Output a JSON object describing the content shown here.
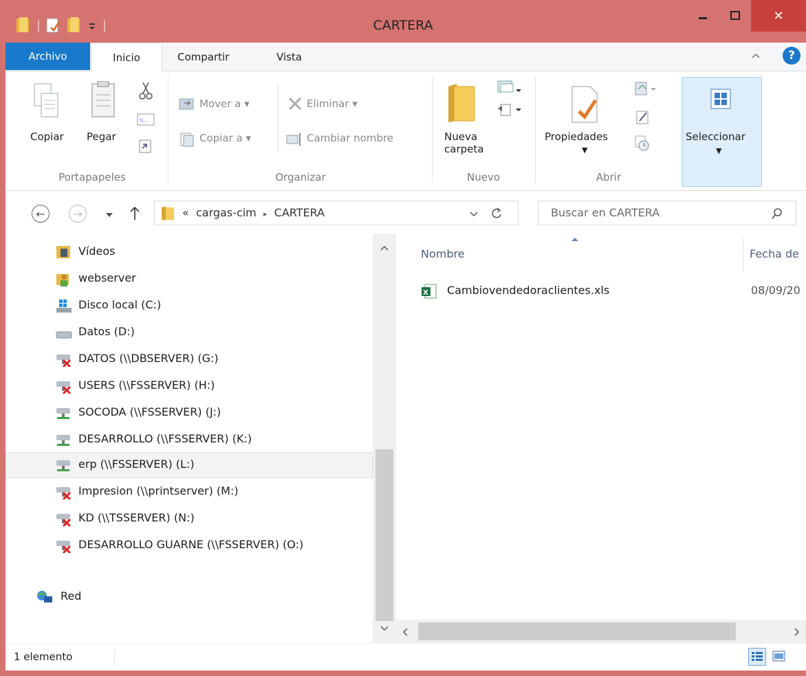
{
  "window": {
    "title": "CARTERA",
    "close_glyph": "✕",
    "accent_frame": "#d57371"
  },
  "ribbon_tabs": {
    "archivo": "Archivo",
    "inicio": "Inicio",
    "compartir": "Compartir",
    "vista": "Vista"
  },
  "ribbon": {
    "copiar": "Copiar",
    "pegar": "Pegar",
    "mover_a": "Mover a",
    "copiar_a": "Copiar a",
    "eliminar": "Eliminar",
    "cambiar_nombre": "Cambiar nombre",
    "nueva_carpeta_1": "Nueva",
    "nueva_carpeta_2": "carpeta",
    "propiedades": "Propiedades",
    "seleccionar": "Seleccionar",
    "groups": {
      "portapapeles": "Portapapeles",
      "organizar": "Organizar",
      "nuevo": "Nuevo",
      "abrir": "Abrir"
    }
  },
  "address": {
    "overflow": "«",
    "crumb1": "cargas-cim",
    "crumb_sep": "▸",
    "crumb2": "CARTERA",
    "search_placeholder": "Buscar en CARTERA"
  },
  "nav_items": [
    {
      "label": "Vídeos",
      "icon": "videos-folder-icon"
    },
    {
      "label": "webserver",
      "icon": "user-folder-icon"
    },
    {
      "label": "Disco local (C:)",
      "icon": "windows-drive-icon"
    },
    {
      "label": "Datos (D:)",
      "icon": "drive-icon"
    },
    {
      "label": "DATOS (\\\\DBSERVER) (G:)",
      "icon": "disconnected-network-drive-icon"
    },
    {
      "label": "USERS (\\\\FSSERVER) (H:)",
      "icon": "disconnected-network-drive-icon"
    },
    {
      "label": "SOCODA (\\\\FSSERVER) (J:)",
      "icon": "network-drive-icon"
    },
    {
      "label": "DESARROLLO (\\\\FSSERVER) (K:)",
      "icon": "network-drive-icon"
    },
    {
      "label": "erp (\\\\FSSERVER) (L:)",
      "icon": "network-drive-icon"
    },
    {
      "label": "Impresion (\\\\printserver) (M:)",
      "icon": "disconnected-network-drive-icon"
    },
    {
      "label": "KD (\\\\TSSERVER) (N:)",
      "icon": "disconnected-network-drive-icon"
    },
    {
      "label": "DESARROLLO GUARNE (\\\\FSSERVER) (O:)",
      "icon": "disconnected-network-drive-icon"
    },
    {
      "label": "Red",
      "icon": "network-icon"
    }
  ],
  "content": {
    "col_name": "Nombre",
    "col_date": "Fecha de",
    "files": [
      {
        "name": "Cambiovendedoraclientes.xls",
        "date": "08/09/20",
        "icon": "excel-file-icon"
      }
    ]
  },
  "status": {
    "count": "1 elemento"
  }
}
